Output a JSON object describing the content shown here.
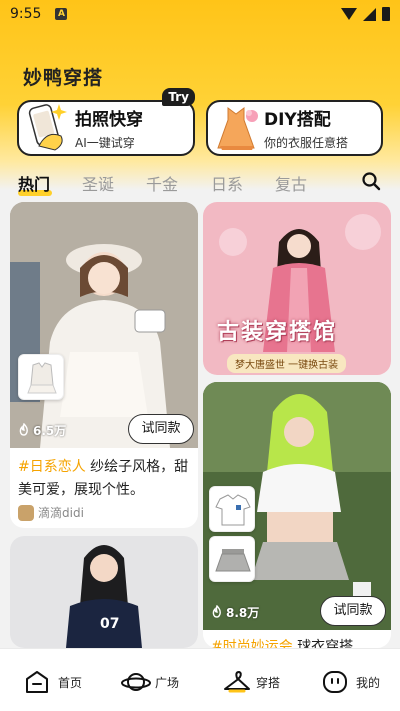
{
  "status_bar": {
    "time": "9:55",
    "notification_glyph": "A"
  },
  "app": {
    "title": "妙鸭穿搭"
  },
  "features": {
    "photo": {
      "title": "拍照快穿",
      "subtitle": "AI一键试穿",
      "badge": "Try"
    },
    "diy": {
      "title": "DIY搭配",
      "subtitle": "你的衣服任意搭"
    }
  },
  "tabs": [
    {
      "label": "热门",
      "active": true
    },
    {
      "label": "圣诞",
      "active": false
    },
    {
      "label": "千金",
      "active": false
    },
    {
      "label": "日系",
      "active": false
    },
    {
      "label": "复古",
      "active": false
    }
  ],
  "feed": {
    "card1": {
      "count": "6.5万",
      "try_label": "试同款",
      "tag": "#日系恋人",
      "desc": " 纱绘子风格，甜美可爱，展现个性。",
      "author": "滴滴didi"
    },
    "banner": {
      "title": "古装穿搭馆",
      "subtitle": "梦大唐盛世 一键换古装"
    },
    "card2": {
      "count": "8.8万",
      "try_label": "试同款",
      "tag": "#时尚妙运会",
      "desc": " 球衣穿搭"
    }
  },
  "bottom_nav": [
    {
      "label": "首页",
      "icon": "home-icon"
    },
    {
      "label": "广场",
      "icon": "planet-icon"
    },
    {
      "label": "穿搭",
      "icon": "hanger-icon"
    },
    {
      "label": "我的",
      "icon": "profile-icon"
    }
  ],
  "colors": {
    "brand_yellow": "#ffd236",
    "tag_orange": "#f5a300"
  }
}
